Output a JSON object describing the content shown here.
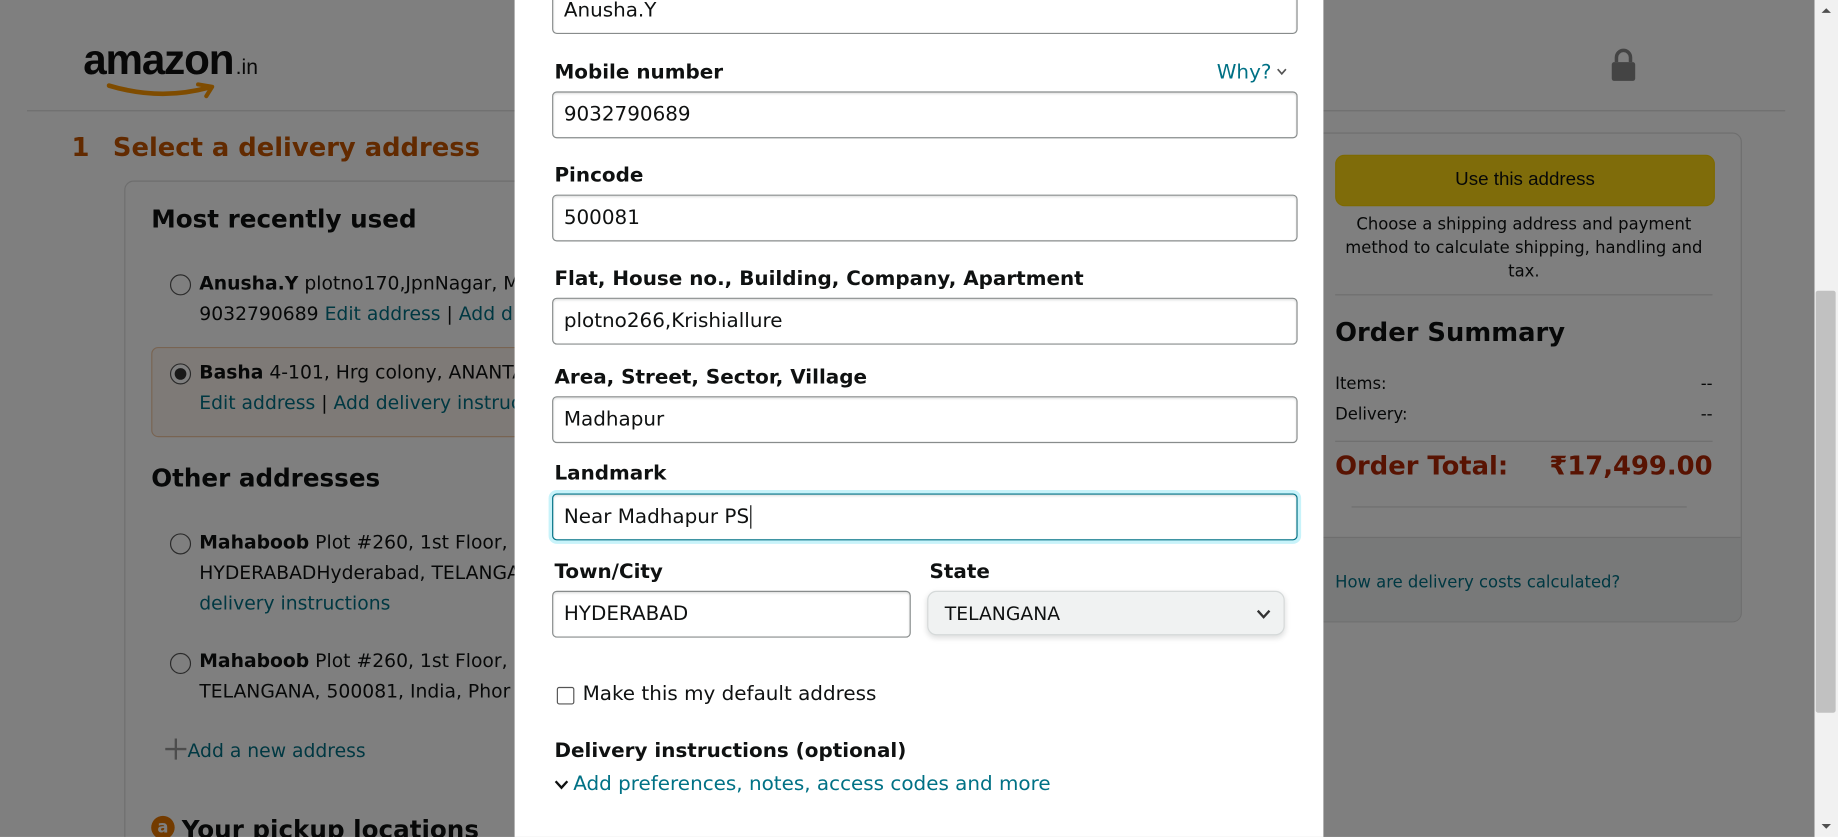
{
  "header": {
    "logo_word": "amazon",
    "logo_tld": ".in"
  },
  "checkout": {
    "step_number": "1",
    "step_title": "Select a delivery address",
    "most_recent_title": "Most recently used",
    "recent": [
      {
        "name": "Anusha.Y",
        "line1": " plotno170,JpnNagar, M",
        "phone": "9032790689",
        "edit": "Edit address",
        "sep": " | ",
        "add": "Add d"
      },
      {
        "name": "Basha",
        "line1": " 4-101, Hrg colony, ANANTA",
        "edit": "Edit address",
        "sep": " | ",
        "add": "Add delivery instruc"
      }
    ],
    "other_title": "Other addresses",
    "other": [
      {
        "name": "Mahaboob",
        "line1": " Plot #260, 1st Floor, K",
        "line2": "HYDERABADHyderabad, TELANGA",
        "line3": "delivery instructions"
      },
      {
        "name": "Mahaboob",
        "line1": " Plot #260, 1st Floor, K",
        "line2": "TELANGANA, 500081, India, Phor"
      }
    ],
    "add_new": "Add a new address",
    "pickup_title": "Your pickup locations",
    "pickup_icon": "a"
  },
  "summary": {
    "use_button": "Use this address",
    "choose_text": "Choose a shipping address and payment method to calculate shipping, handling and tax.",
    "title": "Order Summary",
    "items_label": "Items:",
    "items_value": "--",
    "delivery_label": "Delivery:",
    "delivery_value": "--",
    "total_label": "Order Total:",
    "total_value": "₹17,499.00",
    "delivery_costs_link": "How are delivery costs calculated?"
  },
  "modal": {
    "fullname_value": "Anusha.Y",
    "mobile_label": "Mobile number",
    "why_label": "Why?",
    "mobile_value": "9032790689",
    "pincode_label": "Pincode",
    "pincode_value": "500081",
    "flat_label": "Flat, House no., Building, Company, Apartment",
    "flat_value": "plotno266,Krishiallure",
    "area_label": "Area, Street, Sector, Village",
    "area_value": "Madhapur",
    "landmark_label": "Landmark",
    "landmark_value": "Near Madhapur PS",
    "city_label": "Town/City",
    "city_value": "HYDERABAD",
    "state_label": "State",
    "state_value": "TELANGANA",
    "default_checkbox_label": "Make this my default address",
    "delivery_instructions_title": "Delivery instructions (optional)",
    "delivery_instructions_link": "Add preferences, notes, access codes and more"
  },
  "colors": {
    "accent_link": "#007185",
    "step_orange": "#c45500",
    "total_red": "#b12704",
    "button_yellow": "#ffd814"
  }
}
